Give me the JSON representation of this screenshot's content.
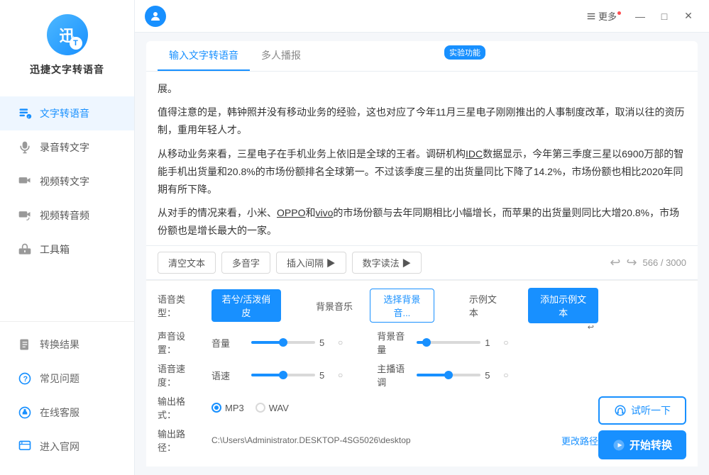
{
  "app": {
    "name": "迅捷文字转语音",
    "logo_text": "迅",
    "logo_sub": "T"
  },
  "user": {
    "avatar_icon": "person",
    "name": ""
  },
  "titlebar": {
    "more_label": "更多",
    "minimize": "—",
    "maximize": "□",
    "close": "✕"
  },
  "tabs": [
    {
      "id": "text-to-speech",
      "label": "输入文字转语音",
      "active": true,
      "badge": "实验功能"
    },
    {
      "id": "multi-broadcast",
      "label": "多人播报",
      "active": false
    }
  ],
  "content": {
    "text": "展。\n\n值得注意的是，韩钟照并没有移动业务的经验，这也对应了今年11月三星电子刚刚推出的人事制度改革，取消以往的资历制，重用年轻人才。\n\n从移动业务来看，三星电子在手机业务上依旧是全球的王者。调研机构IDC数据显示，今年第三季度三星以6900万部的智能手机出货量和20.8%的市场份额排名全球第一。不过该季度三星的出货量同比下降了14.2%，市场份额也相比2020年同期有所下降。\n\n从对手的情况来看，小米、OPPO和vivo的市场份额与去年同期相比小幅增长，而苹果的出货量则同比大增20.8%，市场份额也是增长最大的一家。\n\n除了移动业务面临的挑战，还有一个新的趋势是，随着5G时代的到来，手机与IoT设备的互联互通越来越成为大势所趋。有些手机厂商也开始发力电视、洗衣机等大家电产品，并进行全球化运作。"
  },
  "toolbar": {
    "clear_label": "清空文本",
    "polyphone_label": "多音字",
    "insert_gap_label": "插入间隔 ▶",
    "number_read_label": "数字读法 ▶",
    "char_count": "566 / 3000"
  },
  "settings": {
    "voice_type_label": "语音类型：",
    "voice_type_value": "若兮/活泼俏皮",
    "bg_music_label": "背景音乐",
    "bg_music_btn": "选择背景音...",
    "example_label": "示例文本",
    "add_example_btn": "添加示例文本",
    "volume_label": "音量",
    "volume_value": "5",
    "bg_volume_label": "背景音量",
    "bg_volume_value": "1",
    "speed_label": "语速",
    "speed_value": "5",
    "host_tone_label": "主播语调",
    "host_tone_value": "5",
    "format_label": "输出格式：",
    "format_mp3": "MP3",
    "format_wav": "WAV",
    "path_label": "输出路径：",
    "path_value": "C:\\Users\\Administrator.DESKTOP-4SG5026\\desktop",
    "change_path_label": "更改路径",
    "listen_label": "试听一下",
    "convert_label": "开始转换",
    "sound_setting": "声音设置：",
    "speed_setting": "语音速度："
  },
  "sidebar": {
    "items": [
      {
        "id": "text-to-speech",
        "label": "文字转语音",
        "icon": "📝",
        "active": true
      },
      {
        "id": "audio-to-text",
        "label": "录音转文字",
        "icon": "🎙️",
        "active": false
      },
      {
        "id": "video-to-text",
        "label": "视频转文字",
        "icon": "🎬",
        "active": false
      },
      {
        "id": "video-to-audio",
        "label": "视频转音频",
        "icon": "🎵",
        "active": false
      },
      {
        "id": "toolbox",
        "label": "工具箱",
        "icon": "🧰",
        "active": false
      }
    ],
    "bottom_items": [
      {
        "id": "convert-result",
        "label": "转换结果",
        "icon": "📋"
      },
      {
        "id": "faq",
        "label": "常见问题",
        "icon": "❓"
      },
      {
        "id": "online-service",
        "label": "在线客服",
        "icon": "💬"
      },
      {
        "id": "official-site",
        "label": "进入官网",
        "icon": "🌐"
      }
    ]
  }
}
